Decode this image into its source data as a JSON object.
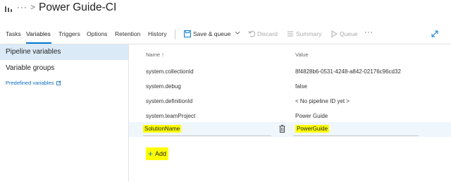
{
  "header": {
    "breadcrumb_dots": "···",
    "separator": ">",
    "title": "Power Guide-CI"
  },
  "tabs": [
    {
      "label": "Tasks"
    },
    {
      "label": "Variables"
    },
    {
      "label": "Triggers"
    },
    {
      "label": "Options"
    },
    {
      "label": "Retention"
    },
    {
      "label": "History"
    }
  ],
  "toolbar": {
    "save_queue": "Save & queue",
    "discard": "Discard",
    "summary": "Summary",
    "queue": "Queue",
    "more": "···"
  },
  "sidebar": {
    "items": [
      {
        "label": "Pipeline variables",
        "selected": true
      },
      {
        "label": "Variable groups",
        "selected": false
      }
    ],
    "predefined_link": "Predefined variables"
  },
  "grid": {
    "columns": {
      "name": "Name",
      "sort_indicator": "↑",
      "value": "Value"
    },
    "rows": [
      {
        "name": "system.collectionId",
        "value": "8f4828b6-0531-4248-a842-02176c96cd32"
      },
      {
        "name": "system.debug",
        "value": "false"
      },
      {
        "name": "system.definitionId",
        "value": "< No pipeline ID yet >"
      },
      {
        "name": "system.teamProject",
        "value": "Power Guide"
      },
      {
        "name": "SolutionName",
        "value": "PowerGuide",
        "editing": true
      }
    ],
    "add_label": "Add"
  },
  "colors": {
    "accent": "#0078d4",
    "highlight": "#ffff00",
    "selected_bg": "#dbeaf7"
  }
}
